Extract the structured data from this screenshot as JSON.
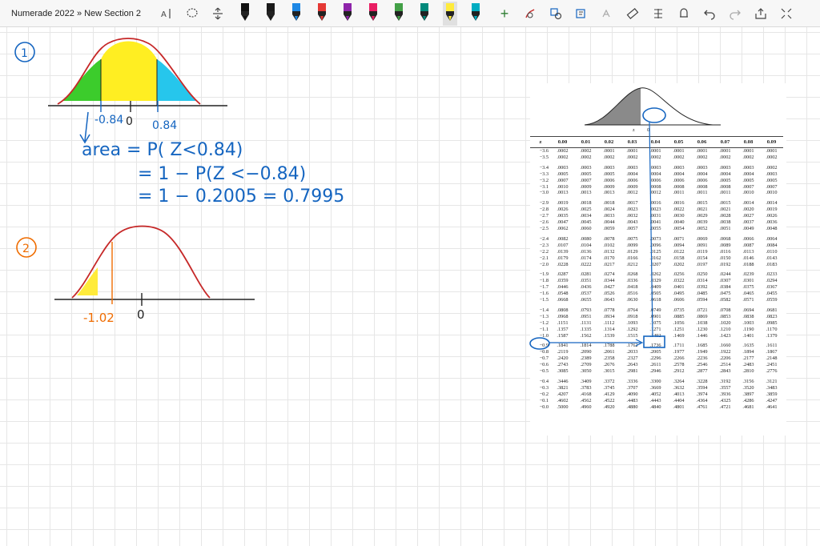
{
  "window": {
    "title": "Numerade 2022 » New Section 2"
  },
  "toolbar": {
    "icons": [
      "text-select-icon",
      "lasso-icon",
      "insert-space-icon",
      "pen-icon",
      "eraser-icon",
      "ruler-icon",
      "undo-icon",
      "redo-icon",
      "share-icon",
      "expand-icon"
    ],
    "pen_colors": [
      "#111111",
      "#1a1a1a",
      "#1e88e5",
      "#e53935",
      "#8e24aa",
      "#e91e63",
      "#43a047",
      "#00897b",
      "#ffeb3b",
      "#00acc1"
    ],
    "selected_pen": "#ffeb3b"
  },
  "notes": {
    "p1_number": "1",
    "p1_left_tick": "-0.84",
    "p1_zero": "0",
    "p1_right_tick": "0.84",
    "p1_line1": "area = P( Z<0.84)",
    "p1_line2": "= 1 − P(Z <−0.84)",
    "p1_line3": "= 1 −  0.2005  =  0.7995",
    "p2_number": "2",
    "p2_left_tick": "-1.02",
    "p2_zero": "0"
  },
  "ztable": {
    "figure_z_label": "z",
    "figure_zero_label": "0",
    "headers": [
      "z",
      "0.00",
      "0.01",
      "0.02",
      "0.03",
      "0.04",
      "0.05",
      "0.06",
      "0.07",
      "0.08",
      "0.09"
    ],
    "rows": [
      [
        "−3.6",
        ".0002",
        ".0002",
        ".0001",
        ".0001",
        ".0001",
        ".0001",
        ".0001",
        ".0001",
        ".0001",
        ".0001"
      ],
      [
        "−3.5",
        ".0002",
        ".0002",
        ".0002",
        ".0002",
        ".0002",
        ".0002",
        ".0002",
        ".0002",
        ".0002",
        ".0002"
      ],
      [],
      [
        "−3.4",
        ".0003",
        ".0003",
        ".0003",
        ".0003",
        ".0003",
        ".0003",
        ".0003",
        ".0003",
        ".0003",
        ".0002"
      ],
      [
        "−3.3",
        ".0005",
        ".0005",
        ".0005",
        ".0004",
        ".0004",
        ".0004",
        ".0004",
        ".0004",
        ".0004",
        ".0003"
      ],
      [
        "−3.2",
        ".0007",
        ".0007",
        ".0006",
        ".0006",
        ".0006",
        ".0006",
        ".0006",
        ".0005",
        ".0005",
        ".0005"
      ],
      [
        "−3.1",
        ".0010",
        ".0009",
        ".0009",
        ".0009",
        ".0008",
        ".0008",
        ".0008",
        ".0008",
        ".0007",
        ".0007"
      ],
      [
        "−3.0",
        ".0013",
        ".0013",
        ".0013",
        ".0012",
        ".0012",
        ".0011",
        ".0011",
        ".0011",
        ".0010",
        ".0010"
      ],
      [],
      [
        "−2.9",
        ".0019",
        ".0018",
        ".0018",
        ".0017",
        ".0016",
        ".0016",
        ".0015",
        ".0015",
        ".0014",
        ".0014"
      ],
      [
        "−2.8",
        ".0026",
        ".0025",
        ".0024",
        ".0023",
        ".0023",
        ".0022",
        ".0021",
        ".0021",
        ".0020",
        ".0019"
      ],
      [
        "−2.7",
        ".0035",
        ".0034",
        ".0033",
        ".0032",
        ".0031",
        ".0030",
        ".0029",
        ".0028",
        ".0027",
        ".0026"
      ],
      [
        "−2.6",
        ".0047",
        ".0045",
        ".0044",
        ".0043",
        ".0041",
        ".0040",
        ".0039",
        ".0038",
        ".0037",
        ".0036"
      ],
      [
        "−2.5",
        ".0062",
        ".0060",
        ".0059",
        ".0057",
        ".0055",
        ".0054",
        ".0052",
        ".0051",
        ".0049",
        ".0048"
      ],
      [],
      [
        "−2.4",
        ".0082",
        ".0080",
        ".0078",
        ".0075",
        ".0073",
        ".0071",
        ".0069",
        ".0068",
        ".0066",
        ".0064"
      ],
      [
        "−2.3",
        ".0107",
        ".0104",
        ".0102",
        ".0099",
        ".0096",
        ".0094",
        ".0091",
        ".0089",
        ".0087",
        ".0084"
      ],
      [
        "−2.2",
        ".0139",
        ".0136",
        ".0132",
        ".0129",
        ".0125",
        ".0122",
        ".0119",
        ".0116",
        ".0113",
        ".0110"
      ],
      [
        "−2.1",
        ".0179",
        ".0174",
        ".0170",
        ".0166",
        ".0162",
        ".0158",
        ".0154",
        ".0150",
        ".0146",
        ".0143"
      ],
      [
        "−2.0",
        ".0228",
        ".0222",
        ".0217",
        ".0212",
        ".0207",
        ".0202",
        ".0197",
        ".0192",
        ".0188",
        ".0183"
      ],
      [],
      [
        "−1.9",
        ".0287",
        ".0281",
        ".0274",
        ".0268",
        ".0262",
        ".0256",
        ".0250",
        ".0244",
        ".0239",
        ".0233"
      ],
      [
        "−1.8",
        ".0359",
        ".0351",
        ".0344",
        ".0336",
        ".0329",
        ".0322",
        ".0314",
        ".0307",
        ".0301",
        ".0294"
      ],
      [
        "−1.7",
        ".0446",
        ".0436",
        ".0427",
        ".0418",
        ".0409",
        ".0401",
        ".0392",
        ".0384",
        ".0375",
        ".0367"
      ],
      [
        "−1.6",
        ".0548",
        ".0537",
        ".0526",
        ".0516",
        ".0505",
        ".0495",
        ".0485",
        ".0475",
        ".0465",
        ".0455"
      ],
      [
        "−1.5",
        ".0668",
        ".0655",
        ".0643",
        ".0630",
        ".0618",
        ".0606",
        ".0594",
        ".0582",
        ".0571",
        ".0559"
      ],
      [],
      [
        "−1.4",
        ".0808",
        ".0793",
        ".0778",
        ".0764",
        ".0749",
        ".0735",
        ".0721",
        ".0708",
        ".0694",
        ".0681"
      ],
      [
        "−1.3",
        ".0968",
        ".0951",
        ".0934",
        ".0918",
        ".0901",
        ".0885",
        ".0869",
        ".0853",
        ".0838",
        ".0823"
      ],
      [
        "−1.2",
        ".1151",
        ".1131",
        ".1112",
        ".1093",
        ".1075",
        ".1056",
        ".1038",
        ".1020",
        ".1003",
        ".0985"
      ],
      [
        "−1.1",
        ".1357",
        ".1335",
        ".1314",
        ".1292",
        ".1271",
        ".1251",
        ".1230",
        ".1210",
        ".1190",
        ".1170"
      ],
      [
        "−1.0",
        ".1587",
        ".1562",
        ".1539",
        ".1515",
        ".1492",
        ".1469",
        ".1446",
        ".1423",
        ".1401",
        ".1379"
      ],
      [],
      [
        "−0.9",
        ".1841",
        ".1814",
        ".1788",
        ".1762",
        ".1736",
        ".1711",
        ".1685",
        ".1660",
        ".1635",
        ".1611"
      ],
      [
        "−0.8",
        ".2119",
        ".2090",
        ".2061",
        ".2033",
        ".2005",
        ".1977",
        ".1949",
        ".1922",
        ".1894",
        ".1867"
      ],
      [
        "−0.7",
        ".2420",
        ".2389",
        ".2358",
        ".2327",
        ".2296",
        ".2266",
        ".2236",
        ".2206",
        ".2177",
        ".2148"
      ],
      [
        "−0.6",
        ".2743",
        ".2709",
        ".2676",
        ".2643",
        ".2611",
        ".2578",
        ".2546",
        ".2514",
        ".2483",
        ".2451"
      ],
      [
        "−0.5",
        ".3085",
        ".3050",
        ".3015",
        ".2981",
        ".2946",
        ".2912",
        ".2877",
        ".2843",
        ".2810",
        ".2776"
      ],
      [],
      [
        "−0.4",
        ".3446",
        ".3409",
        ".3372",
        ".3336",
        ".3300",
        ".3264",
        ".3228",
        ".3192",
        ".3156",
        ".3121"
      ],
      [
        "−0.3",
        ".3821",
        ".3783",
        ".3745",
        ".3707",
        ".3669",
        ".3632",
        ".3594",
        ".3557",
        ".3520",
        ".3483"
      ],
      [
        "−0.2",
        ".4207",
        ".4168",
        ".4129",
        ".4090",
        ".4052",
        ".4013",
        ".3974",
        ".3936",
        ".3897",
        ".3859"
      ],
      [
        "−0.1",
        ".4602",
        ".4562",
        ".4522",
        ".4483",
        ".4443",
        ".4404",
        ".4364",
        ".4325",
        ".4286",
        ".4247"
      ],
      [
        "−0.0",
        ".5000",
        ".4960",
        ".4920",
        ".4880",
        ".4840",
        ".4801",
        ".4761",
        ".4721",
        ".4681",
        ".4641"
      ]
    ]
  }
}
